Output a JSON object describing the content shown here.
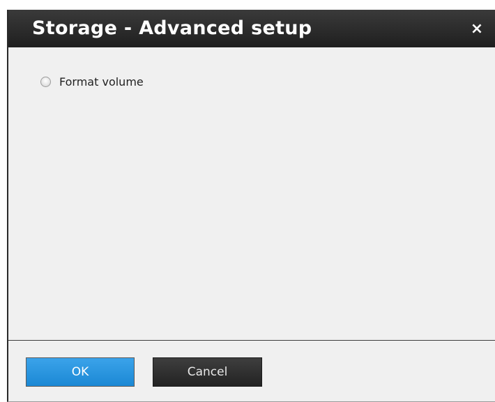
{
  "dialog": {
    "title": "Storage - Advanced setup",
    "close_glyph": "×",
    "option": {
      "label": "Format volume",
      "selected": false
    },
    "buttons": {
      "ok_label": "OK",
      "cancel_label": "Cancel"
    }
  },
  "colors": {
    "titlebar": "#262626",
    "ok_button": "#2596e0",
    "cancel_button": "#2e2e2e",
    "body": "#f0f0f0"
  },
  "icons": {
    "close": "close-icon",
    "radio": "radio-unchecked-icon"
  }
}
